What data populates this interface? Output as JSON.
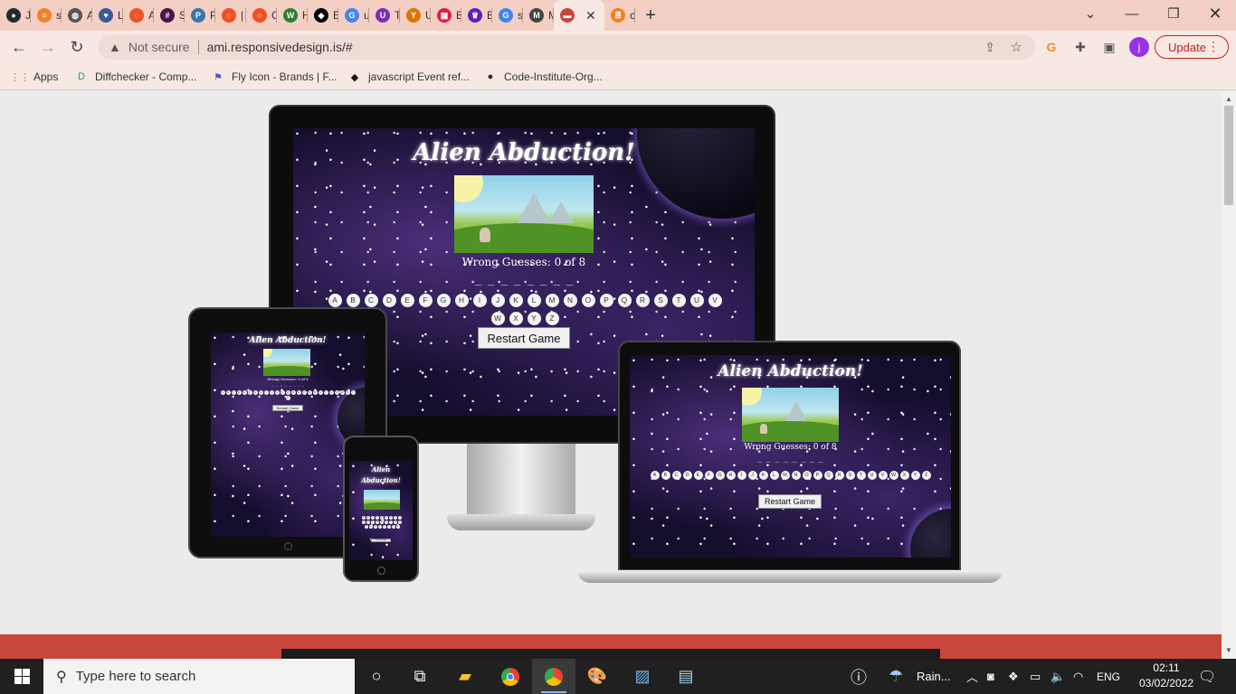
{
  "browser": {
    "tabs": [
      {
        "label": "Jar",
        "icon": "github-icon",
        "color": "#24292e"
      },
      {
        "label": "sty",
        "icon": "stackoverflow-icon",
        "color": "#f48024"
      },
      {
        "label": "Ali",
        "icon": "globe-icon",
        "color": "#555555"
      },
      {
        "label": "Lo",
        "icon": "heart-icon",
        "color": "#3b5998"
      },
      {
        "label": "Ad",
        "icon": "circle-icon",
        "color": "#f25022"
      },
      {
        "label": "Sla",
        "icon": "slack-icon",
        "color": "#4a154b"
      },
      {
        "label": "Pyt",
        "icon": "python-icon",
        "color": "#3776ab"
      },
      {
        "label": "| C",
        "icon": "circle-icon",
        "color": "#f25022"
      },
      {
        "label": "Co",
        "icon": "circle-icon",
        "color": "#f25022"
      },
      {
        "label": "HT",
        "icon": "w-icon",
        "color": "#2e7d32"
      },
      {
        "label": "Ele",
        "icon": "codepen-icon",
        "color": "#000000"
      },
      {
        "label": "ufc",
        "icon": "google-icon",
        "color": "#4285f4"
      },
      {
        "label": "Th",
        "icon": "u-icon",
        "color": "#7b2cbf"
      },
      {
        "label": "Un",
        "icon": "fork-icon",
        "color": "#d97706"
      },
      {
        "label": "Bro",
        "icon": "grid-icon",
        "color": "#e11d48"
      },
      {
        "label": "Be",
        "icon": "crown-icon",
        "color": "#5b21b6"
      },
      {
        "label": "sta",
        "icon": "google-icon",
        "color": "#4285f4"
      },
      {
        "label": "Ma",
        "icon": "m-icon",
        "color": "#444444"
      },
      {
        "label": "",
        "icon": "page-icon",
        "color": "#c9463d",
        "active": true
      },
      {
        "label": "css",
        "icon": "stack-icon",
        "color": "#f48024"
      }
    ],
    "new_tab": "+",
    "security_label": "Not secure",
    "url": "ami.responsivedesign.is/#",
    "profile_initial": "j",
    "update_label": "Update",
    "bookmarks": [
      {
        "label": "Apps",
        "icon": "apps-grid-icon"
      },
      {
        "label": "Diffchecker - Comp...",
        "icon": "diffchecker-icon"
      },
      {
        "label": "Fly Icon - Brands | F...",
        "icon": "flag-icon"
      },
      {
        "label": "javascript Event ref...",
        "icon": "codepen-icon"
      },
      {
        "label": "Code-Institute-Org...",
        "icon": "github-icon"
      }
    ]
  },
  "mockup": {
    "game_title": "Alien Abduction!",
    "wrong_guesses": "Wrong Guesses: 0 of 8",
    "word_blanks": "_ _ _ _ _ _ _ _",
    "keyboard": [
      "A",
      "B",
      "C",
      "D",
      "E",
      "F",
      "G",
      "H",
      "I",
      "J",
      "K",
      "L",
      "M",
      "N",
      "O",
      "P",
      "Q",
      "R",
      "S",
      "T",
      "U",
      "V",
      "W",
      "X",
      "Y",
      "Z"
    ],
    "restart_label": "Restart Game",
    "colors": {
      "space": "#150d2c",
      "page_band": "#c9463d"
    }
  },
  "taskbar": {
    "search_placeholder": "Type here to search",
    "weather": "Rain...",
    "language": "ENG",
    "time": "02:11",
    "date": "03/02/2022"
  }
}
